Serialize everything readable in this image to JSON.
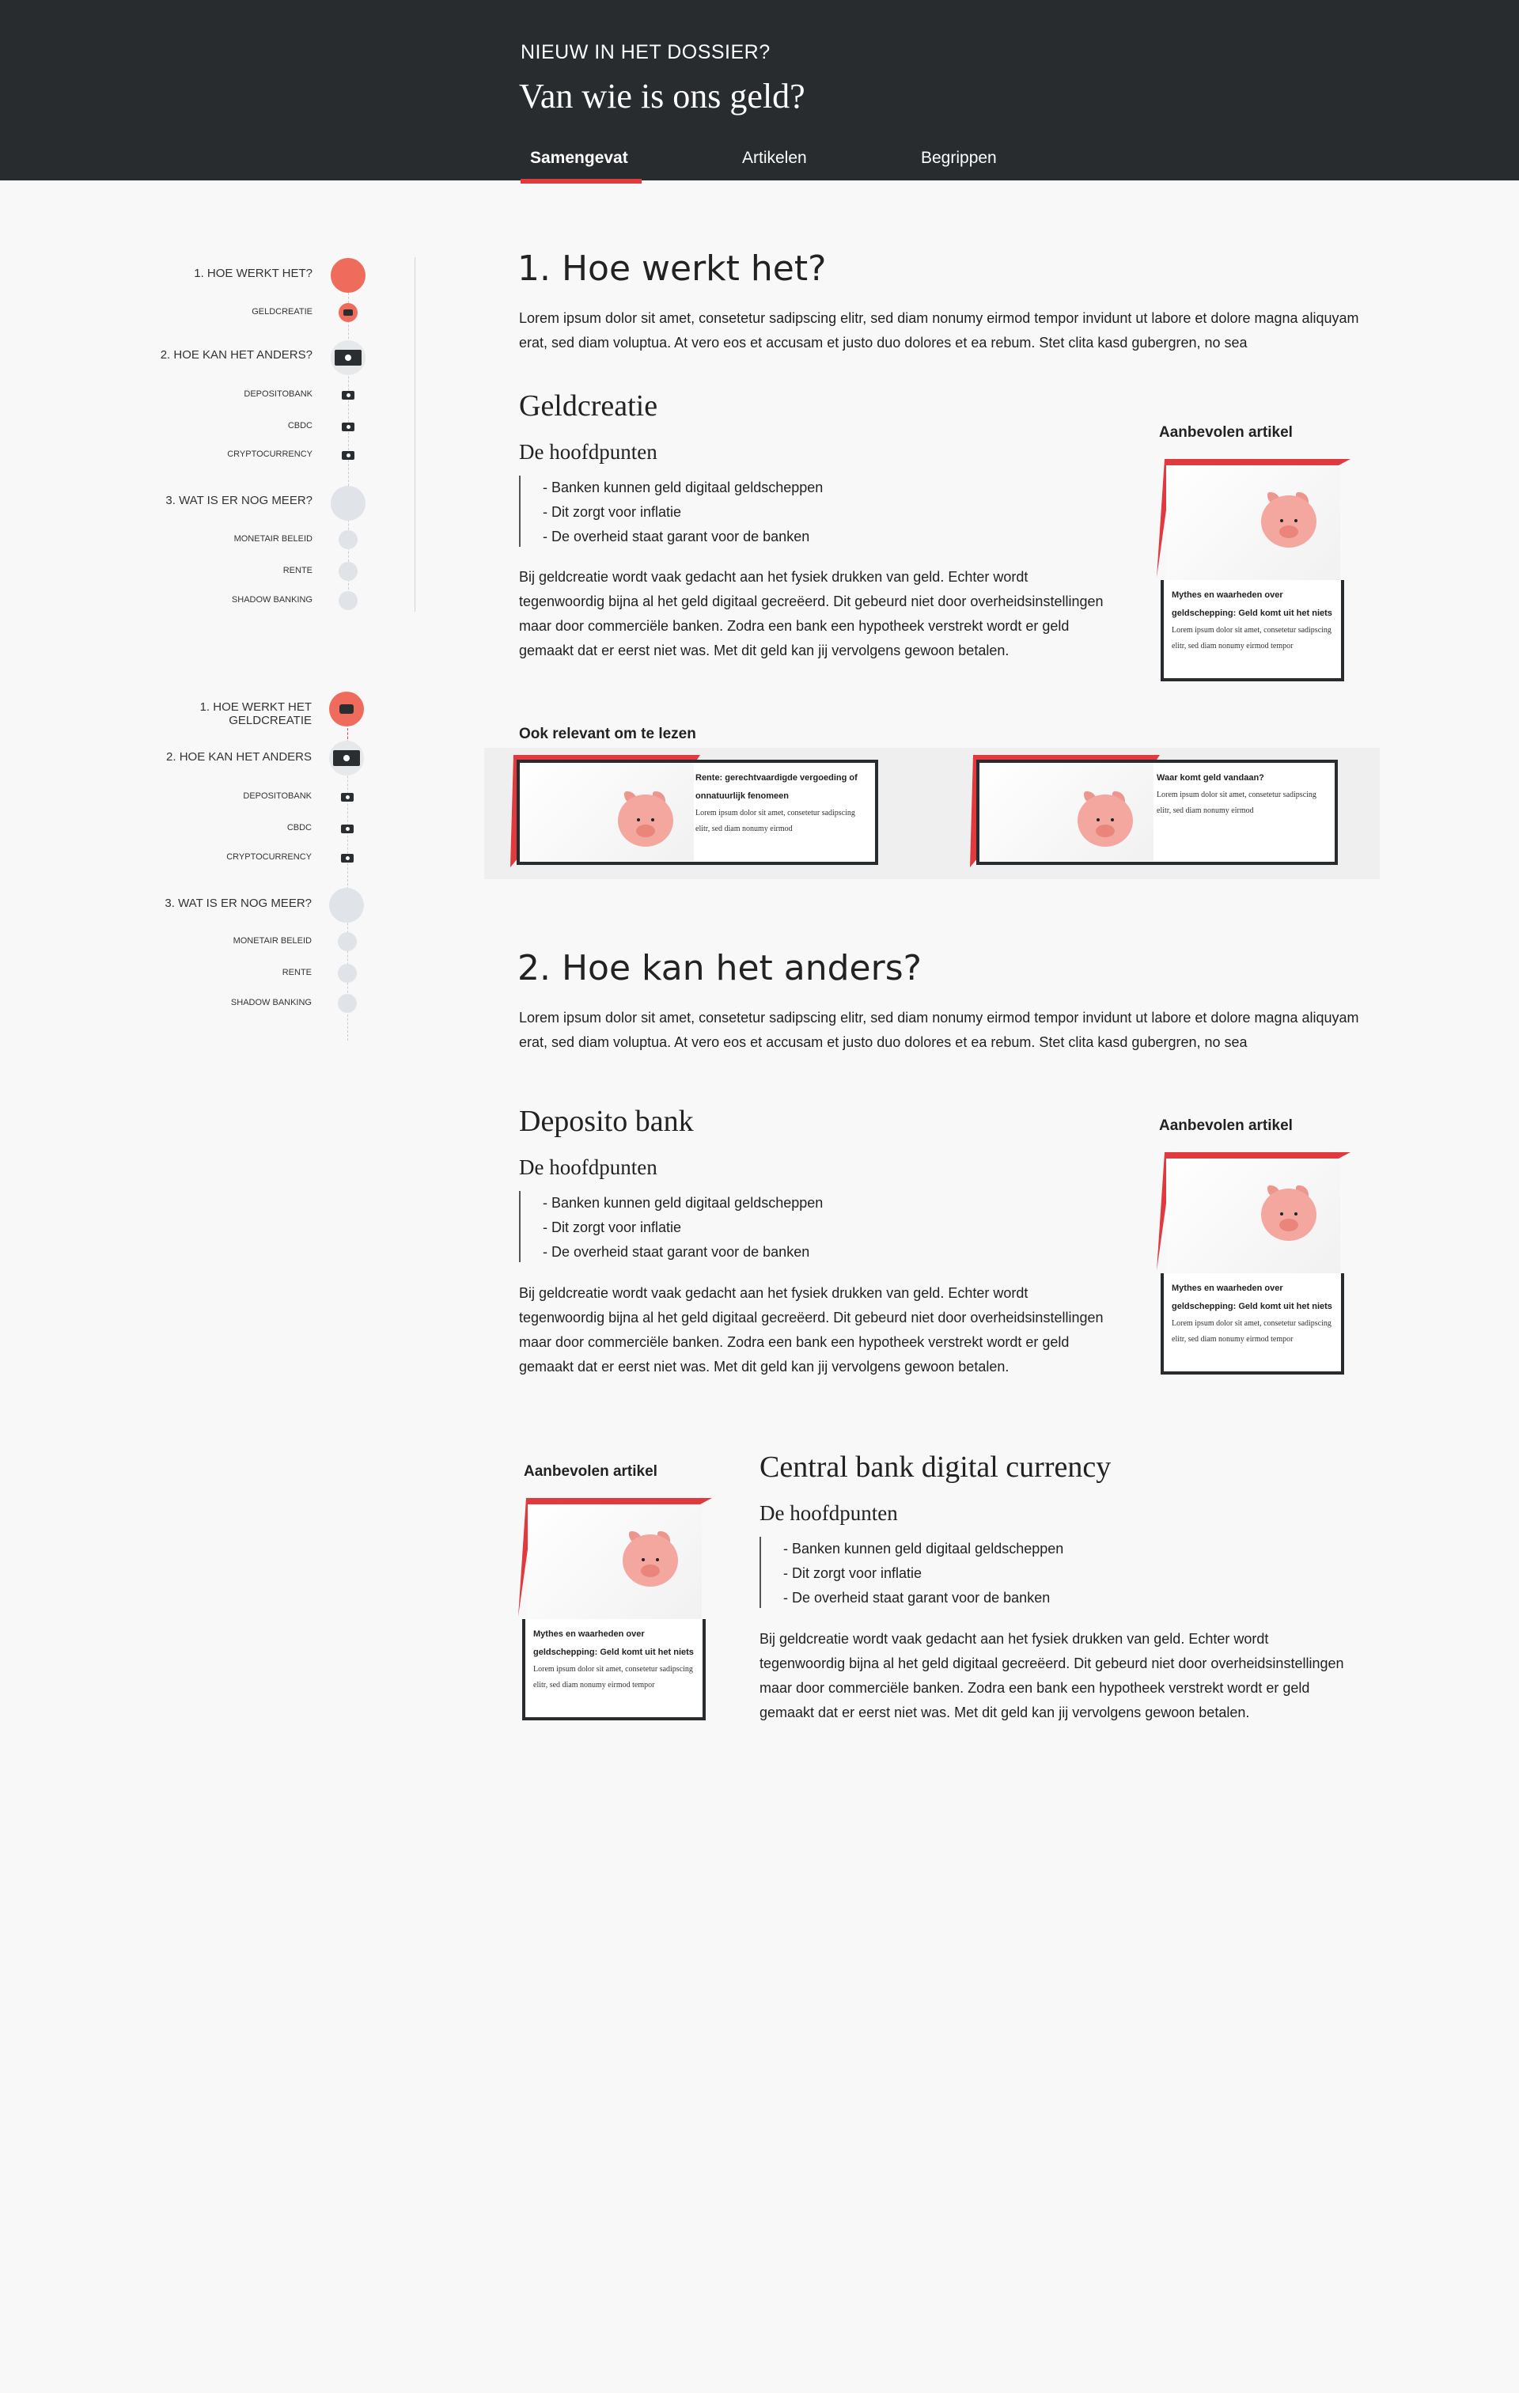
{
  "header": {
    "kicker": "NIEUW IN HET DOSSIER?",
    "title": "Van wie is ons geld?",
    "tabs": [
      {
        "label": "Samengevat",
        "active": true
      },
      {
        "label": "Artikelen",
        "active": false
      },
      {
        "label": "Begrippen",
        "active": false
      }
    ]
  },
  "nav1": {
    "main1": "1. HOE WERKT HET?",
    "sub1": "GELDCREATIE",
    "main2": "2. HOE KAN HET ANDERS?",
    "sub2a": "DEPOSITOBANK",
    "sub2b": "CBDC",
    "sub2c": "CRYPTOCURRENCY",
    "main3": "3. WAT IS ER NOG MEER?",
    "sub3a": "MONETAIR BELEID",
    "sub3b": "RENTE",
    "sub3c": "SHADOW BANKING"
  },
  "nav2": {
    "main1a": "1. HOE WERKT HET",
    "main1b": "GELDCREATIE",
    "main2": "2. HOE KAN HET ANDERS",
    "sub2a": "DEPOSITOBANK",
    "sub2b": "CBDC",
    "sub2c": "CRYPTOCURRENCY",
    "main3": "3. WAT IS ER NOG MEER?",
    "sub3a": "MONETAIR BELEID",
    "sub3b": "RENTE",
    "sub3c": "SHADOW BANKING"
  },
  "section1": {
    "heading": "1. Hoe werkt het?",
    "lead": "Lorem ipsum dolor sit amet, consetetur sadipscing elitr, sed diam nonumy eirmod tempor invidunt ut labore et dolore magna aliquyam erat, sed diam voluptua. At vero eos et accusam et justo duo dolores et ea rebum. Stet clita kasd gubergren, no sea",
    "sub_heading": "Geldcreatie",
    "points_heading": "De hoofdpunten",
    "points": [
      "- Banken kunnen geld digitaal geldscheppen",
      "- Dit zorgt voor inflatie",
      "- De overheid staat garant voor de banken"
    ],
    "body": "Bij geldcreatie wordt vaak gedacht aan het fysiek drukken van geld. Echter wordt tegenwoordig bijna al het geld digitaal gecreëerd. Dit gebeurd niet door overheidsinstellingen maar door commerciële banken. Zodra een bank een hypotheek verstrekt wordt er geld gemaakt dat er eerst niet was. Met dit geld kan jij vervolgens gewoon betalen.",
    "recommended_label": "Aanbevolen artikel",
    "card": {
      "title": "Mythes en waarheden over geldschepping: Geld komt uit het niets",
      "body": "Lorem ipsum dolor sit amet, consetetur sadipscing elitr, sed diam nonumy eirmod tempor"
    },
    "relevant_label": "Ook relevant om te lezen",
    "relevant": [
      {
        "title": "Rente: gerechtvaardigde vergoeding of onnatuurlijk fenomeen",
        "body": "Lorem ipsum dolor sit amet, consetetur sadipscing elitr, sed diam nonumy eirmod"
      },
      {
        "title": "Waar komt geld vandaan?",
        "body": "Lorem ipsum dolor sit amet, consetetur sadipscing elitr, sed diam nonumy eirmod"
      }
    ]
  },
  "section2": {
    "heading": "2. Hoe kan het anders?",
    "lead": "Lorem ipsum dolor sit amet, consetetur sadipscing elitr, sed diam nonumy eirmod tempor invidunt ut labore et dolore magna aliquyam erat, sed diam voluptua. At vero eos et accusam et justo duo dolores et ea rebum. Stet clita kasd gubergren, no sea",
    "sub_heading": "Deposito bank",
    "points_heading": "De hoofdpunten",
    "points": [
      "- Banken kunnen geld digitaal geldscheppen",
      "- Dit zorgt voor inflatie",
      "- De overheid staat garant voor de banken"
    ],
    "body": "Bij geldcreatie wordt vaak gedacht aan het fysiek drukken van geld. Echter wordt tegenwoordig bijna al het geld digitaal gecreëerd. Dit gebeurd niet door overheidsinstellingen maar door commerciële banken. Zodra een bank een hypotheek verstrekt wordt er geld gemaakt dat er eerst niet was. Met dit geld kan jij vervolgens gewoon betalen.",
    "recommended_label": "Aanbevolen artikel",
    "card": {
      "title": "Mythes en waarheden over geldschepping: Geld komt uit het niets",
      "body": "Lorem ipsum dolor sit amet, consetetur sadipscing elitr, sed diam nonumy eirmod tempor"
    }
  },
  "section3": {
    "recommended_label": "Aanbevolen artikel",
    "card": {
      "title": "Mythes en waarheden over geldschepping: Geld komt uit het niets",
      "body": "Lorem ipsum dolor sit amet, consetetur sadipscing elitr, sed diam nonumy eirmod tempor"
    },
    "sub_heading": "Central bank digital currency",
    "points_heading": "De hoofdpunten",
    "points": [
      "- Banken kunnen geld digitaal geldscheppen",
      "- Dit zorgt voor inflatie",
      "- De overheid staat garant voor de banken"
    ],
    "body": "Bij geldcreatie wordt vaak gedacht aan het fysiek drukken van geld. Echter wordt tegenwoordig bijna al het geld digitaal gecreëerd. Dit gebeurd niet door overheidsinstellingen maar door commerciële banken. Zodra een bank een hypotheek verstrekt wordt er geld gemaakt dat er eerst niet was. Met dit geld kan jij vervolgens gewoon betalen."
  },
  "colors": {
    "header_bg": "#282c2f",
    "accent": "#e03a3e",
    "dot_active": "#ef6b5c",
    "dot_inactive": "#e0e3e7"
  }
}
